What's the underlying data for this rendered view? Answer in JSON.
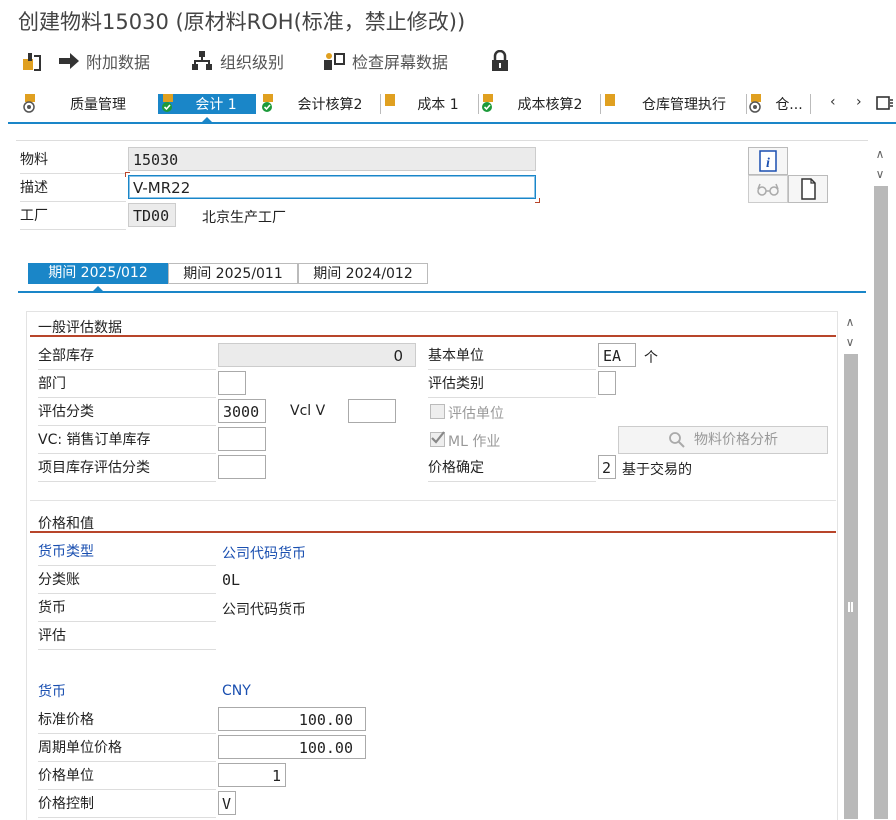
{
  "window": {
    "title": "创建物料15030 (原材料ROH(标准，禁止修改))"
  },
  "toolbar": {
    "additional_data": "附加数据",
    "org_levels": "组织级别",
    "check_screen": "检查屏幕数据"
  },
  "tabs": [
    {
      "label": "质量管理",
      "active": false
    },
    {
      "label": "会计 1",
      "active": true
    },
    {
      "label": "会计核算2",
      "active": false
    },
    {
      "label": "成本 1",
      "active": false
    },
    {
      "label": "成本核算2",
      "active": false
    },
    {
      "label": "仓库管理执行",
      "active": false
    },
    {
      "label": "仓...",
      "active": false
    }
  ],
  "header": {
    "material_label": "物料",
    "material_value": "15030",
    "desc_label": "描述",
    "desc_value": "V-MR22",
    "plant_label": "工厂",
    "plant_code": "TD00",
    "plant_name": "北京生产工厂"
  },
  "periods": [
    "期间 2025/012",
    "期间 2025/011",
    "期间 2024/012"
  ],
  "general": {
    "title": "一般评估数据",
    "total_stock_label": "全部库存",
    "total_stock_value": "0",
    "base_unit_label": "基本单位",
    "base_unit_value": "EA",
    "base_unit_text": "个",
    "division_label": "部门",
    "valuation_cat_label": "评估类别",
    "valuation_class_label": "评估分类",
    "valuation_class_value": "3000",
    "vcl_label": "Vcl V",
    "valuation_unit_label": "评估单位",
    "vc_so_label": "VC: 销售订单库存",
    "ml_label": "ML 作业",
    "price_analysis_button": "物料价格分析",
    "project_stock_label": "项目库存评估分类",
    "price_determination_label": "价格确定",
    "price_determination_value": "2",
    "price_determination_text": "基于交易的"
  },
  "prices": {
    "title": "价格和值",
    "currency_type_label": "货币类型",
    "currency_type_value": "公司代码货币",
    "ledger_label": "分类账",
    "ledger_value": "0L",
    "currency_label": "货币",
    "currency_value": "公司代码货币",
    "valuation_label": "评估",
    "currency2_label": "货币",
    "currency2_value": "CNY",
    "std_price_label": "标准价格",
    "std_price_value": "100.00",
    "periodic_price_label": "周期单位价格",
    "periodic_price_value": "100.00",
    "price_unit_label": "价格单位",
    "price_unit_value": "1",
    "price_control_label": "价格控制",
    "price_control_value": "V"
  },
  "colors": {
    "accent": "#1a86c8",
    "section_line": "#b8452a",
    "link_blue": "#1a4fb0"
  }
}
